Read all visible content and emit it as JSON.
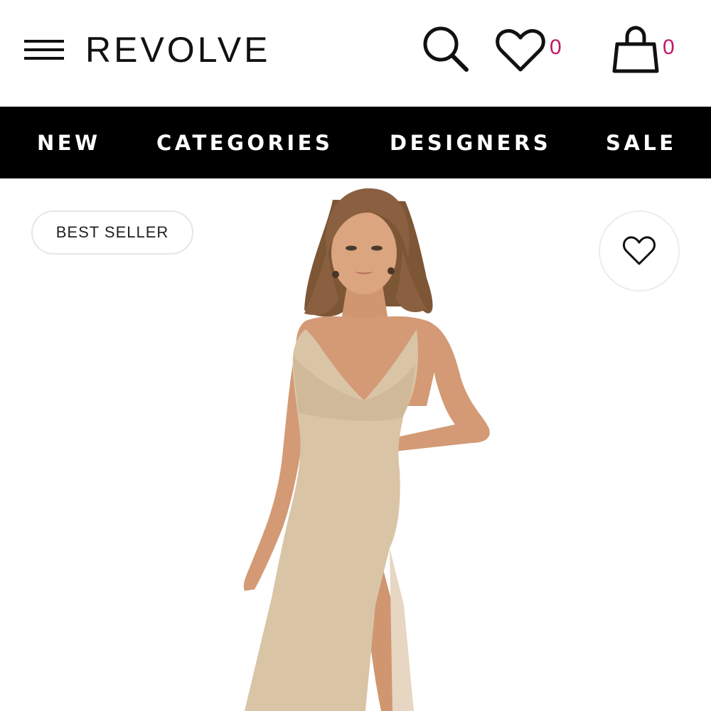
{
  "header": {
    "logo": "REVOLVE",
    "wishlist_count": "0",
    "bag_count": "0",
    "icons": [
      "menu-icon",
      "search-icon",
      "heart-icon",
      "shopping-bag-icon"
    ]
  },
  "nav": {
    "items": [
      "NEW",
      "CATEGORIES",
      "DESIGNERS",
      "SALE"
    ]
  },
  "product": {
    "badge": "BEST SELLER",
    "image": "model-in-champagne-sequin-gown",
    "favorite_icon": "heart-icon"
  },
  "colors": {
    "accent_count": "#c2186b",
    "nav_background": "#000000",
    "gown": "#d9c4a6",
    "skin": "#d9a07c",
    "hair": "#8a6040"
  }
}
